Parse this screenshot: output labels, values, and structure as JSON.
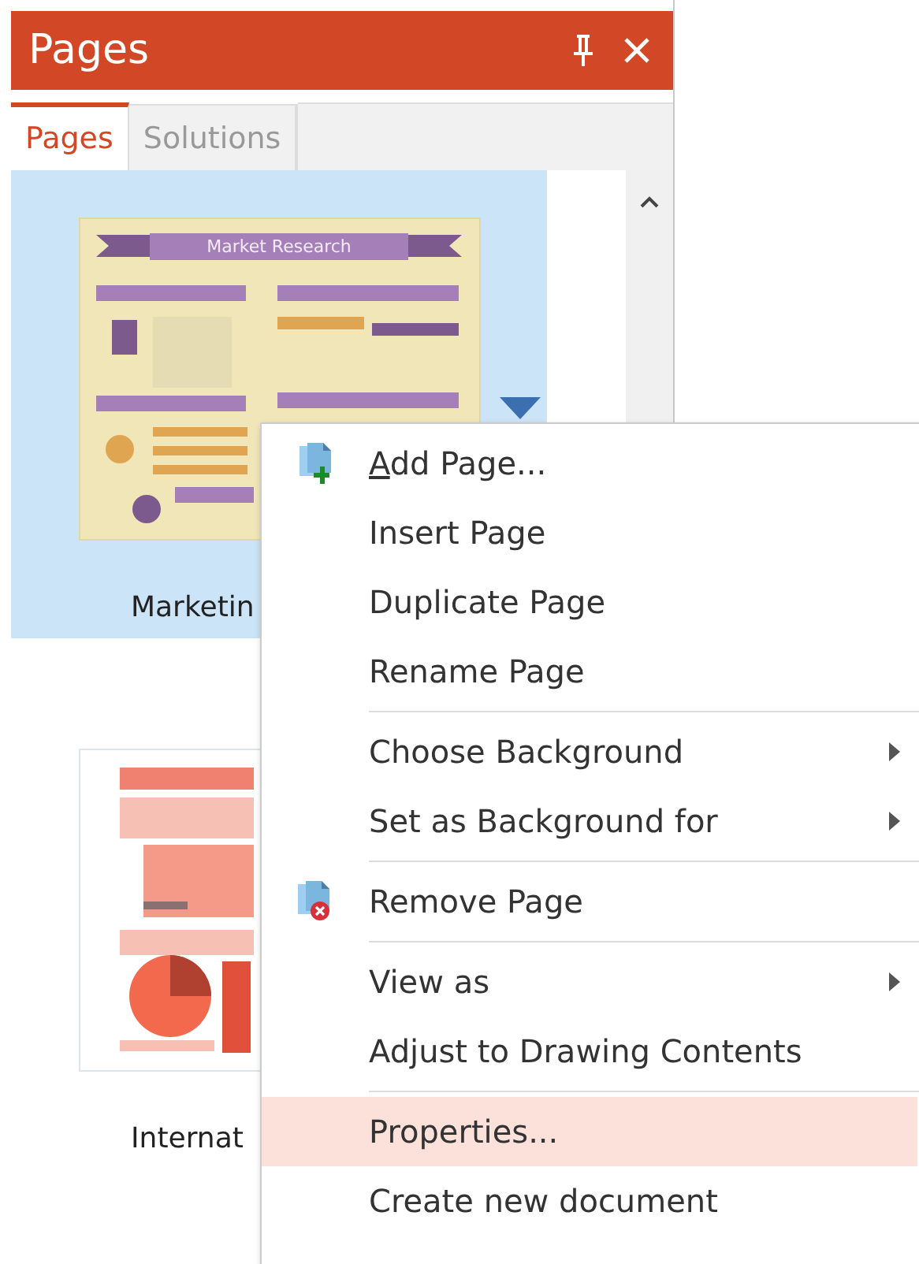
{
  "panel": {
    "title": "Pages"
  },
  "tabs": [
    {
      "label": "Pages",
      "selected": true
    },
    {
      "label": "Solutions",
      "selected": false
    }
  ],
  "pages": [
    {
      "label": "Marketin",
      "selected": true,
      "kind": "infographic",
      "thumbnail_title": "Market Research"
    },
    {
      "label": "Internat",
      "selected": false,
      "kind": "report"
    }
  ],
  "context_menu": [
    {
      "kind": "add_item",
      "label": "Add Page...",
      "access_key_underlined": true,
      "submenu": false,
      "selected": false
    },
    {
      "kind": "item",
      "label": "Insert Page",
      "submenu": false,
      "selected": false
    },
    {
      "kind": "item",
      "label": "Duplicate Page",
      "submenu": false,
      "selected": false
    },
    {
      "kind": "item",
      "label": "Rename Page",
      "submenu": false,
      "selected": false
    },
    {
      "kind": "separator"
    },
    {
      "kind": "item",
      "label": "Choose Background",
      "submenu": true,
      "selected": false
    },
    {
      "kind": "item",
      "label": "Set as Background for",
      "submenu": true,
      "selected": false
    },
    {
      "kind": "separator"
    },
    {
      "kind": "remove_item",
      "label": "Remove Page",
      "submenu": false,
      "selected": false
    },
    {
      "kind": "separator"
    },
    {
      "kind": "item",
      "label": "View as",
      "submenu": true,
      "selected": false
    },
    {
      "kind": "item",
      "label": "Adjust to Drawing Contents",
      "submenu": false,
      "selected": false
    },
    {
      "kind": "separator"
    },
    {
      "kind": "item",
      "label": "Properties...",
      "submenu": false,
      "selected": true
    },
    {
      "kind": "item",
      "label": "Create new document",
      "submenu": false,
      "selected": false
    }
  ]
}
